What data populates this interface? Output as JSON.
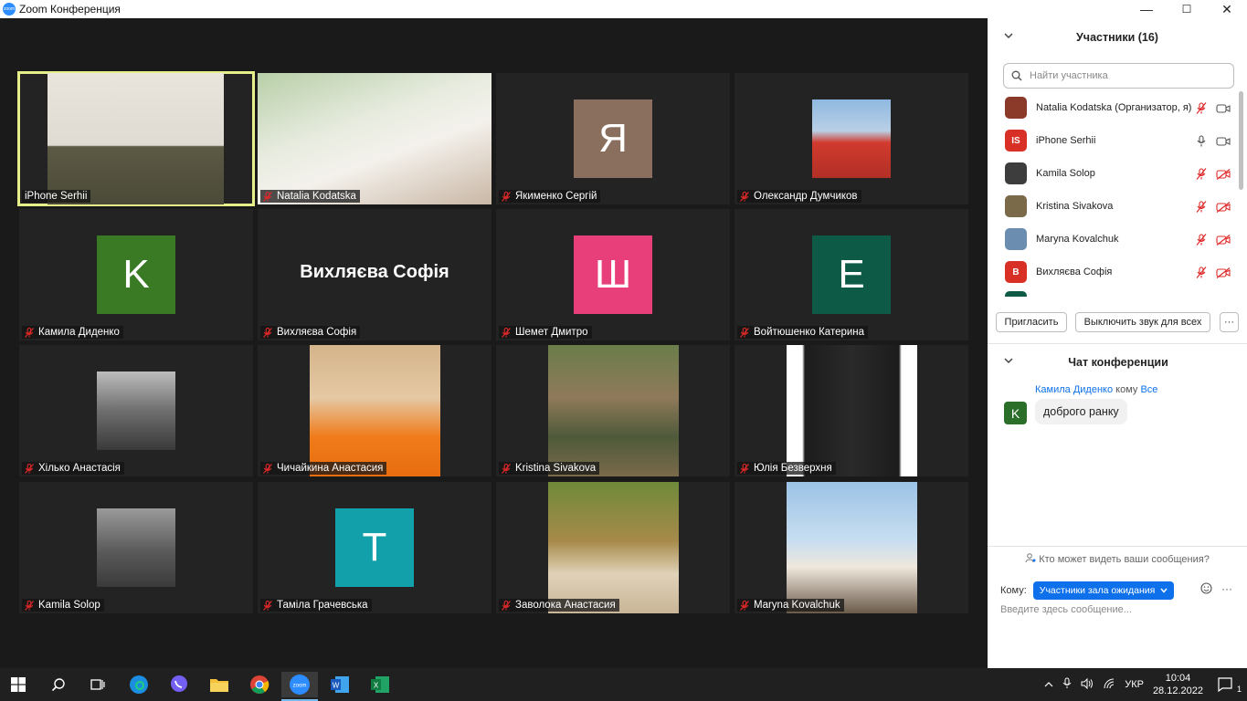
{
  "window": {
    "title": "Zoom Конференция",
    "logo_text": "zoom",
    "controls": [
      "—",
      "☐",
      "✕"
    ]
  },
  "gallery": {
    "tiles": [
      {
        "name": "iPhone Serhii",
        "muted": false,
        "active": true
      },
      {
        "name": "Natalia Kodatska",
        "muted": true
      },
      {
        "name": "Якименко Сергій",
        "muted": true,
        "avatar_letter": "Я",
        "avatar_color": "#8a6e5e"
      },
      {
        "name": "Олександр Думчиков",
        "muted": true
      },
      {
        "name": "Камила Диденко",
        "muted": true,
        "avatar_letter": "K",
        "avatar_color": "#3b7a24"
      },
      {
        "name": "Вихляєва Софія",
        "muted": true,
        "big_name": "Вихляєва Софія"
      },
      {
        "name": "Шемет Дмитро",
        "muted": true,
        "avatar_letter": "Ш",
        "avatar_color": "#e83e7a"
      },
      {
        "name": "Войтюшенко Катерина",
        "muted": true,
        "avatar_letter": "E",
        "avatar_color": "#0d5a46"
      },
      {
        "name": "Хілько  Анастасія",
        "muted": true
      },
      {
        "name": "Чичайкина Анастасия",
        "muted": true
      },
      {
        "name": "Kristina Sivakova",
        "muted": true
      },
      {
        "name": "Юлія Безверхня",
        "muted": true
      },
      {
        "name": "Kamila Solop",
        "muted": true
      },
      {
        "name": "Таміла Грачевська",
        "muted": true,
        "avatar_letter": "T",
        "avatar_color": "#12a0aa"
      },
      {
        "name": "Заволока Анастасия",
        "muted": true
      },
      {
        "name": "Maryna Kovalchuk",
        "muted": true
      }
    ]
  },
  "participants": {
    "title": "Участники (16)",
    "search_placeholder": "Найти участника",
    "list": [
      {
        "name": "Natalia Kodatska (Организатор, я)",
        "initials": "",
        "color": "#8b3a2a"
      },
      {
        "name": "iPhone Serhii",
        "initials": "IS",
        "color": "#d93025"
      },
      {
        "name": "Kamila Solop",
        "initials": "",
        "color": "#3d3d3d"
      },
      {
        "name": "Kristina Sivakova",
        "initials": "",
        "color": "#7a6a4a"
      },
      {
        "name": "Maryna Kovalchuk",
        "initials": "",
        "color": "#6a8db0"
      },
      {
        "name": "Вихляєва Софія",
        "initials": "B",
        "color": "#d93025"
      }
    ],
    "invite_label": "Пригласить",
    "mute_all_label": "Выключить звук для всех",
    "more_label": "···"
  },
  "chat": {
    "title": "Чат конференции",
    "sender": "Камила Диденко",
    "to_word": "кому",
    "recipient": "Все",
    "avatar_letter": "K",
    "message": "доброго ранку",
    "who_can_see": "Кто может видеть ваши сообщения?",
    "to_label": "Кому:",
    "to_value": "Участники зала ожидания",
    "input_placeholder": "Введите здесь сообщение..."
  },
  "taskbar": {
    "language": "УКР",
    "time": "10:04",
    "date": "28.12.2022",
    "notification_count": "1"
  }
}
